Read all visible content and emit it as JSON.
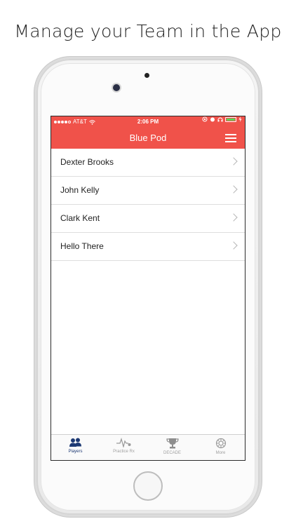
{
  "headline": "Manage your Team in the App",
  "status_bar": {
    "carrier": "AT&T",
    "time": "2:06 PM"
  },
  "nav": {
    "title": "Blue Pod",
    "menu_icon": "hamburger-menu-icon"
  },
  "players": [
    {
      "name": "Dexter Brooks"
    },
    {
      "name": "John Kelly"
    },
    {
      "name": "Clark Kent"
    },
    {
      "name": "Hello There"
    }
  ],
  "tabs": [
    {
      "label": "Players",
      "icon": "players-icon",
      "active": true
    },
    {
      "label": "Practice Rx",
      "icon": "pulse-icon",
      "active": false
    },
    {
      "label": "DECADE",
      "icon": "trophy-icon",
      "active": false
    },
    {
      "label": "More",
      "icon": "gear-icon",
      "active": false
    }
  ],
  "colors": {
    "header": "#f0524a",
    "active_tab": "#1e3a74",
    "inactive_tab": "#a0a0a0",
    "battery": "#57d657"
  }
}
